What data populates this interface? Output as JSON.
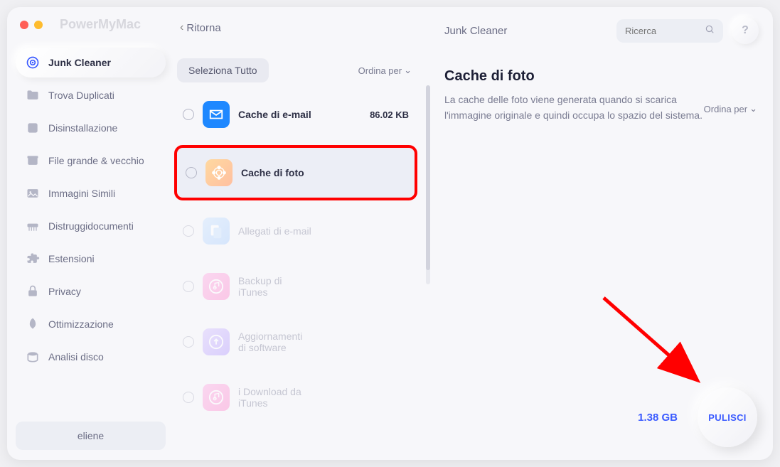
{
  "app_name": "PowerMyMac",
  "back_label": "Ritorna",
  "header_middle": "Junk Cleaner",
  "search_placeholder": "Ricerca",
  "help_label": "?",
  "sidebar": {
    "items": [
      {
        "label": "Junk Cleaner",
        "active": true
      },
      {
        "label": "Trova Duplicati"
      },
      {
        "label": "Disinstallazione"
      },
      {
        "label": "File grande & vecchio"
      },
      {
        "label": "Immagini Simili"
      },
      {
        "label": "Distruggidocumenti"
      },
      {
        "label": "Estensioni"
      },
      {
        "label": "Privacy"
      },
      {
        "label": "Ottimizzazione"
      },
      {
        "label": "Analisi disco"
      }
    ],
    "user": "eliene"
  },
  "toolbar": {
    "select_all": "Seleziona Tutto",
    "sort_by": "Ordina per"
  },
  "items": [
    {
      "label": "Cache di e-mail",
      "size": "86.02 KB",
      "icon": "mail",
      "highlight": false,
      "dim": false
    },
    {
      "label": "Cache di foto",
      "size": "",
      "icon": "photo",
      "highlight": true,
      "dim": false
    },
    {
      "label": "Allegati di e-mail",
      "size": "",
      "icon": "attach",
      "highlight": false,
      "dim": true
    },
    {
      "label": "Backup di\niTunes",
      "size": "",
      "icon": "itunes",
      "highlight": false,
      "dim": true
    },
    {
      "label": "Aggiornamenti\ndi software",
      "size": "",
      "icon": "update",
      "highlight": false,
      "dim": true
    },
    {
      "label": "i Download da\niTunes",
      "size": "",
      "icon": "dl",
      "highlight": false,
      "dim": true
    }
  ],
  "detail": {
    "heading": "Cache di foto",
    "description": "La cache delle foto viene generata quando si scarica l'immagine originale e quindi occupa lo spazio del sistema.",
    "sort_by": "Ordina per"
  },
  "footer": {
    "total_size": "1.38 GB",
    "clean_label": "PULISCI"
  }
}
